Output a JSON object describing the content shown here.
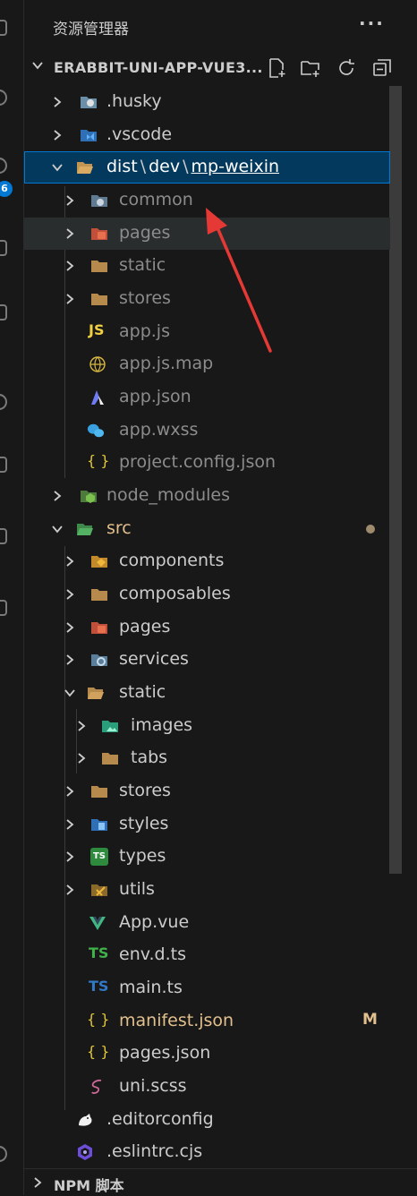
{
  "explorer": {
    "title": "资源管理器",
    "more_icon": "more-horizontal-icon",
    "project_name": "ERABBIT-UNI-APP-VUE3...",
    "actions": [
      "new-file-icon",
      "new-folder-icon",
      "refresh-icon",
      "collapse-all-icon"
    ]
  },
  "activity_bar": {
    "badge": "6"
  },
  "tree": [
    {
      "label": ".husky",
      "kind": "folder",
      "icon": "husky-folder-icon"
    },
    {
      "label": ".vscode",
      "kind": "folder",
      "icon": "vscode-folder-icon"
    },
    {
      "label_parts": [
        "dist",
        "dev",
        "mp-weixin"
      ],
      "kind": "folder-open",
      "icon": "folder-open-icon"
    },
    {
      "label": "common",
      "kind": "folder",
      "icon": "common-folder-icon"
    },
    {
      "label": "pages",
      "kind": "folder",
      "icon": "pages-folder-icon"
    },
    {
      "label": "static",
      "kind": "folder",
      "icon": "folder-icon"
    },
    {
      "label": "stores",
      "kind": "folder",
      "icon": "folder-icon"
    },
    {
      "label": "app.js",
      "kind": "file",
      "icon": "javascript-icon",
      "icon_text": "JS"
    },
    {
      "label": "app.js.map",
      "kind": "file",
      "icon": "js-map-icon"
    },
    {
      "label": "app.json",
      "kind": "file",
      "icon": "json-app-icon"
    },
    {
      "label": "app.wxss",
      "kind": "file",
      "icon": "wechat-icon"
    },
    {
      "label": "project.config.json",
      "kind": "file",
      "icon": "json-braces-icon",
      "icon_text": "{ }"
    },
    {
      "label": "node_modules",
      "kind": "folder",
      "icon": "node-modules-folder-icon"
    },
    {
      "label": "src",
      "kind": "folder-open",
      "icon": "src-folder-icon"
    },
    {
      "label": "components",
      "kind": "folder",
      "icon": "components-folder-icon"
    },
    {
      "label": "composables",
      "kind": "folder",
      "icon": "folder-icon"
    },
    {
      "label": "pages",
      "kind": "folder",
      "icon": "pages-folder-icon"
    },
    {
      "label": "services",
      "kind": "folder",
      "icon": "services-folder-icon"
    },
    {
      "label": "static",
      "kind": "folder-open",
      "icon": "folder-open-icon"
    },
    {
      "label": "images",
      "kind": "folder",
      "icon": "images-folder-icon"
    },
    {
      "label": "tabs",
      "kind": "folder",
      "icon": "folder-icon"
    },
    {
      "label": "stores",
      "kind": "folder",
      "icon": "folder-icon"
    },
    {
      "label": "styles",
      "kind": "folder",
      "icon": "styles-folder-icon"
    },
    {
      "label": "types",
      "kind": "folder",
      "icon": "types-folder-icon",
      "icon_text": "TS"
    },
    {
      "label": "utils",
      "kind": "folder",
      "icon": "utils-folder-icon"
    },
    {
      "label": "App.vue",
      "kind": "file",
      "icon": "vue-icon"
    },
    {
      "label": "env.d.ts",
      "kind": "file",
      "icon": "typescript-def-icon",
      "icon_text": "TS"
    },
    {
      "label": "main.ts",
      "kind": "file",
      "icon": "typescript-icon",
      "icon_text": "TS"
    },
    {
      "label": "manifest.json",
      "kind": "file",
      "icon": "json-braces-icon",
      "icon_text": "{ }",
      "status": "M"
    },
    {
      "label": "pages.json",
      "kind": "file",
      "icon": "json-braces-icon",
      "icon_text": "{ }"
    },
    {
      "label": "uni.scss",
      "kind": "file",
      "icon": "sass-icon"
    },
    {
      "label": ".editorconfig",
      "kind": "file",
      "icon": "editorconfig-icon"
    },
    {
      "label": ".eslintrc.cjs",
      "kind": "file",
      "icon": "eslint-icon"
    }
  ],
  "npm_section": {
    "label": "NPM 脚本"
  },
  "colors": {
    "selected_bg": "#04395e",
    "selected_border": "#0078d4",
    "modified": "#e2c08d",
    "annotation_arrow": "#e53935"
  }
}
